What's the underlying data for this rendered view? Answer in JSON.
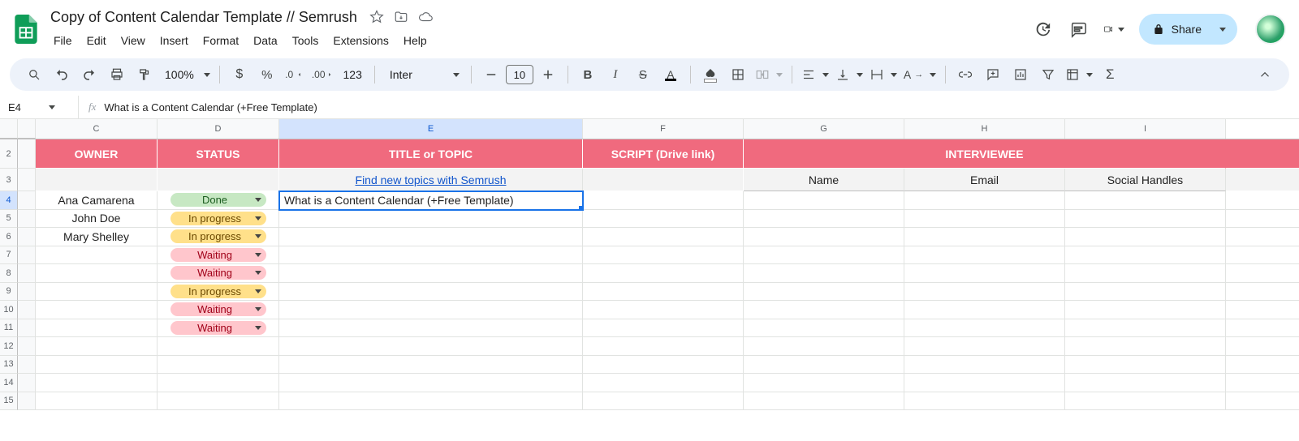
{
  "doc": {
    "title": "Copy of Content Calendar Template // Semrush"
  },
  "menu": [
    "File",
    "Edit",
    "View",
    "Insert",
    "Format",
    "Data",
    "Tools",
    "Extensions",
    "Help"
  ],
  "share": {
    "label": "Share"
  },
  "toolbar": {
    "zoom": "100%",
    "num_fmt": "123",
    "font": "Inter",
    "font_size": "10"
  },
  "namebox": "E4",
  "formula": "What is a Content Calendar (+Free Template)",
  "columns": [
    "C",
    "D",
    "E",
    "F",
    "G",
    "H",
    "I"
  ],
  "selected_col_index": 2,
  "row_numbers": [
    "2",
    "3",
    "4",
    "5",
    "6",
    "7",
    "8",
    "9",
    "10",
    "11",
    "12",
    "13",
    "14",
    "15"
  ],
  "selected_row_index": 2,
  "headers": {
    "owner": "OWNER",
    "status": "STATUS",
    "title": "TITLE or TOPIC",
    "script": "SCRIPT (Drive link)",
    "interviewee": "INTERVIEWEE",
    "sub_name": "Name",
    "sub_email": "Email",
    "sub_social": "Social Handles",
    "topics_link": "Find new topics with Semrush"
  },
  "rows": [
    {
      "owner": "Ana Camarena",
      "status": "Done",
      "status_cls": "done",
      "title": "What is a Content Calendar (+Free Template)"
    },
    {
      "owner": "John Doe",
      "status": "In progress",
      "status_cls": "prog",
      "title": ""
    },
    {
      "owner": "Mary Shelley",
      "status": "In progress",
      "status_cls": "prog",
      "title": ""
    },
    {
      "owner": "",
      "status": "Waiting",
      "status_cls": "wait",
      "title": ""
    },
    {
      "owner": "",
      "status": "Waiting",
      "status_cls": "wait",
      "title": ""
    },
    {
      "owner": "",
      "status": "In progress",
      "status_cls": "prog",
      "title": ""
    },
    {
      "owner": "",
      "status": "Waiting",
      "status_cls": "wait",
      "title": ""
    },
    {
      "owner": "",
      "status": "Waiting",
      "status_cls": "wait",
      "title": ""
    }
  ]
}
